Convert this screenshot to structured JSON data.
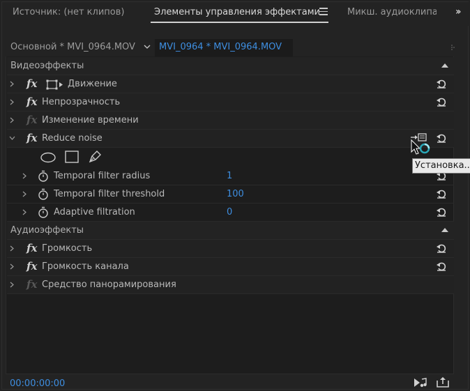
{
  "tabs": [
    {
      "label": "Источник: (нет клипов)",
      "active": false
    },
    {
      "label": "Элементы управления эффектами",
      "active": true
    },
    {
      "label": "Микш. аудиоклипа:",
      "active": false
    }
  ],
  "clip_header": {
    "master": "Основной * MVI_0964.MOV",
    "sequence": "MVI_0964 * MVI_0964.MOV"
  },
  "video_section": {
    "label": "Видеоэффекты"
  },
  "video_effects": [
    {
      "name": "Движение",
      "enabled": true,
      "expanded": false
    },
    {
      "name": "Непрозрачность",
      "enabled": true,
      "expanded": false
    },
    {
      "name": "Изменение времени",
      "enabled": false,
      "expanded": false
    },
    {
      "name": "Reduce noise",
      "enabled": true,
      "expanded": true
    }
  ],
  "reduce_noise_params": [
    {
      "name": "Temporal filter radius",
      "value": "1"
    },
    {
      "name": "Temporal filter threshold",
      "value": "100"
    },
    {
      "name": "Adaptive filtration",
      "value": "0"
    }
  ],
  "audio_section": {
    "label": "Аудиоэффекты"
  },
  "audio_effects": [
    {
      "name": "Громкость",
      "enabled": true
    },
    {
      "name": "Громкость канала",
      "enabled": true
    },
    {
      "name": "Средство панорамирования",
      "enabled": false
    }
  ],
  "tooltip": "Установка...",
  "footer": {
    "timecode": "00:00:00:00"
  },
  "colors": {
    "accent": "#3e8ee0",
    "background": "#232323",
    "panel": "#1d1d1d"
  },
  "icons": {
    "fx": "fx",
    "reset": "reset-icon",
    "stopwatch": "stopwatch-icon",
    "ellipse_mask": "ellipse-mask-icon",
    "rect_mask": "rectangle-mask-icon",
    "pen_mask": "pen-mask-icon"
  }
}
